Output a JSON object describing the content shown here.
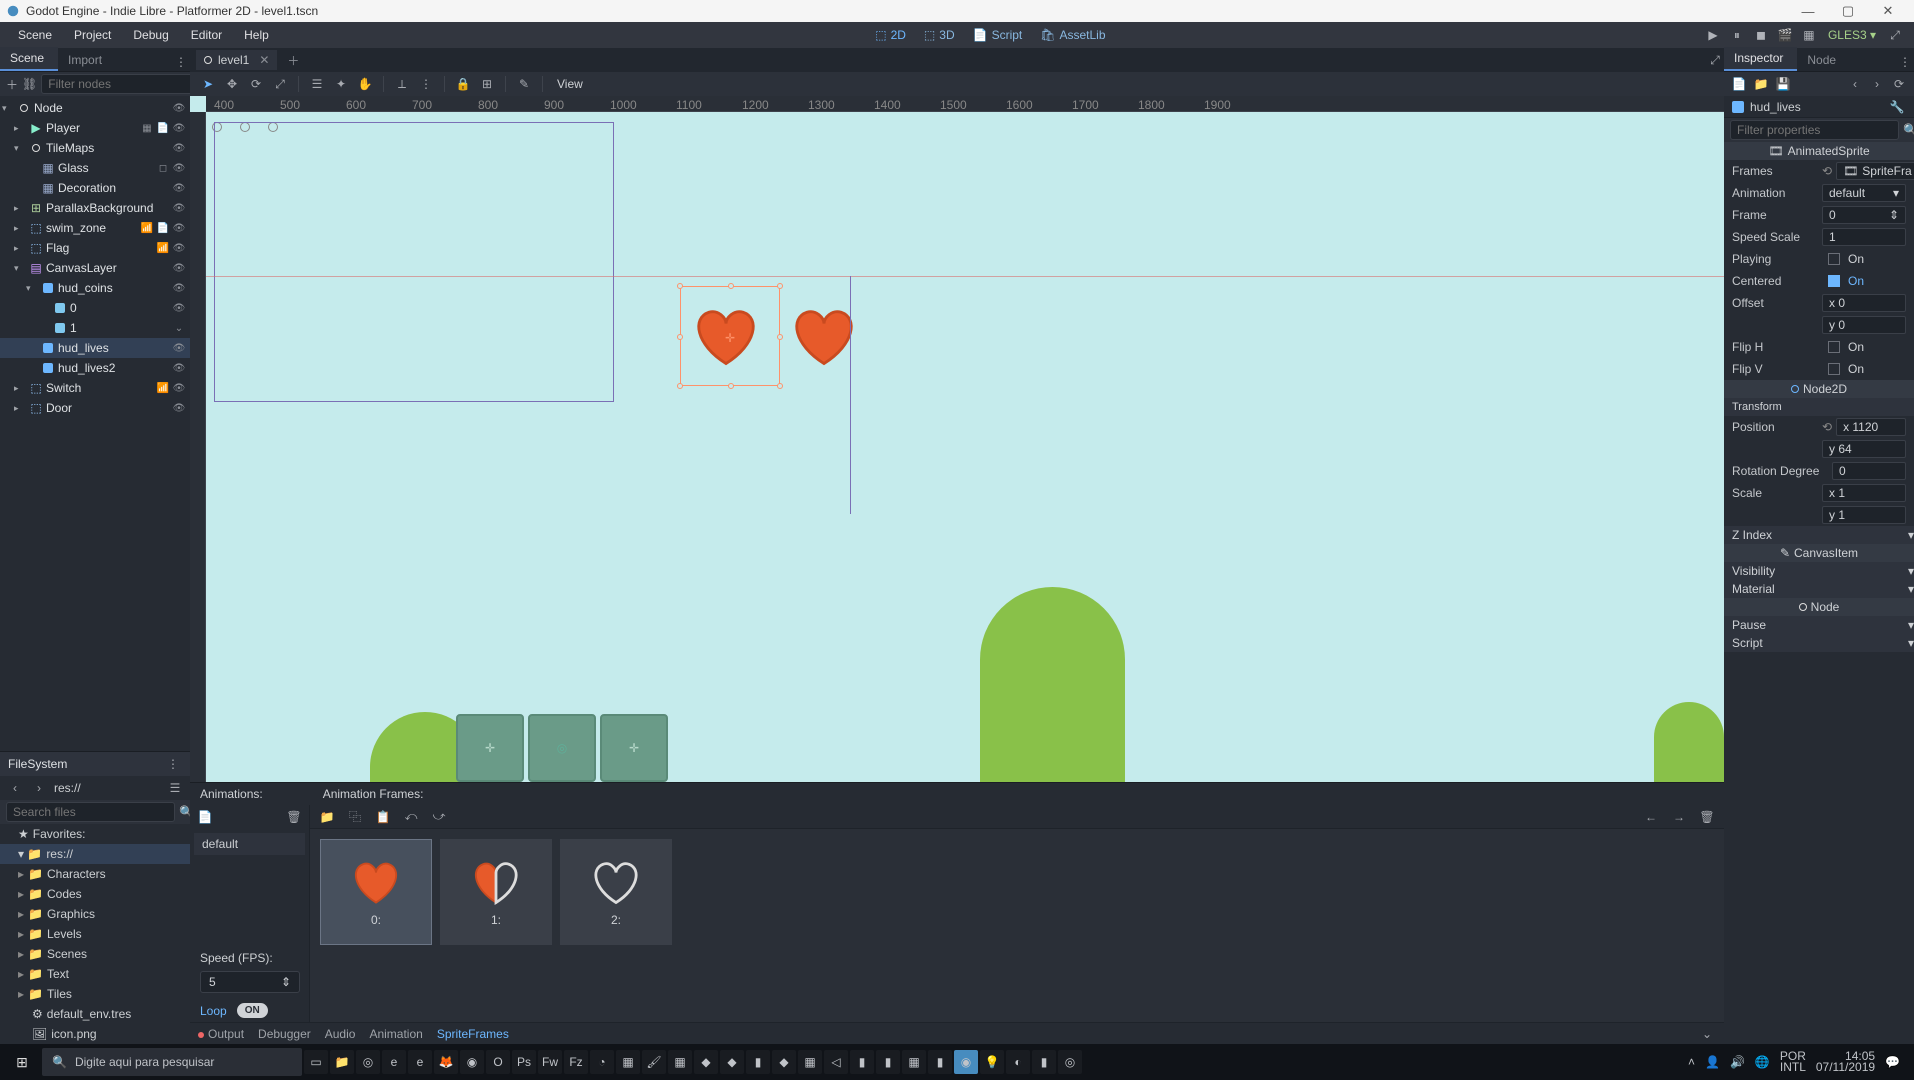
{
  "titlebar": {
    "text": "Godot Engine - Indie Libre - Platformer 2D - level1.tscn"
  },
  "menubar": {
    "items": [
      "Scene",
      "Project",
      "Debug",
      "Editor",
      "Help"
    ],
    "modes": {
      "m2d": "2D",
      "m3d": "3D",
      "script": "Script",
      "assetlib": "AssetLib"
    },
    "gles": "GLES3"
  },
  "left_tabs": {
    "scene": "Scene",
    "import": "Import"
  },
  "tree_filter_placeholder": "Filter nodes",
  "tree": [
    {
      "lvl": 0,
      "chev": "▾",
      "icon": "c-white",
      "label": "Node",
      "ract": [
        "👁"
      ]
    },
    {
      "lvl": 1,
      "chev": "▸",
      "icon": "play",
      "label": "Player",
      "ract": [
        "▦",
        "📄",
        "👁"
      ]
    },
    {
      "lvl": 1,
      "chev": "▾",
      "icon": "c-white",
      "label": "TileMaps",
      "ract": [
        "👁"
      ]
    },
    {
      "lvl": 2,
      "chev": "",
      "icon": "grid",
      "label": "Glass",
      "ract": [
        "◻",
        "👁"
      ]
    },
    {
      "lvl": 2,
      "chev": "",
      "icon": "grid",
      "label": "Decoration",
      "ract": [
        "👁"
      ]
    },
    {
      "lvl": 1,
      "chev": "▸",
      "icon": "plx",
      "label": "ParallaxBackground",
      "ract": [
        "👁"
      ]
    },
    {
      "lvl": 1,
      "chev": "▸",
      "icon": "area",
      "label": "swim_zone",
      "ract": [
        "📶",
        "📄",
        "👁"
      ]
    },
    {
      "lvl": 1,
      "chev": "▸",
      "icon": "area",
      "label": "Flag",
      "ract": [
        "📶",
        "👁"
      ]
    },
    {
      "lvl": 1,
      "chev": "▾",
      "icon": "layer",
      "label": "CanvasLayer",
      "ract": [
        "👁"
      ]
    },
    {
      "lvl": 2,
      "chev": "▾",
      "icon": "hud",
      "label": "hud_coins",
      "ract": [
        "👁"
      ]
    },
    {
      "lvl": 3,
      "chev": "",
      "icon": "spr",
      "label": "0",
      "ract": [
        "👁"
      ]
    },
    {
      "lvl": 3,
      "chev": "",
      "icon": "spr",
      "label": "1",
      "ract": [
        "⌄"
      ]
    },
    {
      "lvl": 2,
      "chev": "",
      "icon": "hud",
      "label": "hud_lives",
      "ract": [
        "👁"
      ],
      "sel": true
    },
    {
      "lvl": 2,
      "chev": "",
      "icon": "hud",
      "label": "hud_lives2",
      "ract": [
        "👁"
      ]
    },
    {
      "lvl": 1,
      "chev": "▸",
      "icon": "area",
      "label": "Switch",
      "ract": [
        "📶",
        "👁"
      ]
    },
    {
      "lvl": 1,
      "chev": "▸",
      "icon": "area",
      "label": "Door",
      "ract": [
        "👁"
      ]
    }
  ],
  "fs": {
    "title": "FileSystem",
    "path": "res://",
    "search_placeholder": "Search files",
    "fav": "Favorites:",
    "root": "res://",
    "folders": [
      "Characters",
      "Codes",
      "Graphics",
      "Levels",
      "Scenes",
      "Text",
      "Tiles"
    ],
    "files": [
      "default_env.tres",
      "icon.png"
    ]
  },
  "scenetab": {
    "name": "level1"
  },
  "view_label": "View",
  "ruler_marks": [
    "400",
    "500",
    "600",
    "700",
    "800",
    "900",
    "1000",
    "1100",
    "1200",
    "1300",
    "1400",
    "1500",
    "1600",
    "1700",
    "1800",
    "1900"
  ],
  "anim": {
    "hdr_anim": "Animations:",
    "hdr_frames": "Animation Frames:",
    "default": "default",
    "speed_lbl": "Speed (FPS):",
    "speed_val": "5",
    "loop_lbl": "Loop",
    "loop_on": "ON",
    "frame_labels": [
      "0:",
      "1:",
      "2:"
    ]
  },
  "bottom_tabs": {
    "output": "Output",
    "debugger": "Debugger",
    "audio": "Audio",
    "animation": "Animation",
    "spriteframes": "SpriteFrames"
  },
  "inspector": {
    "tabs": {
      "inspector": "Inspector",
      "node": "Node"
    },
    "node": "hud_lives",
    "filter_placeholder": "Filter properties",
    "class": "AnimatedSprite",
    "props": {
      "frames_lbl": "Frames",
      "frames_val": "SpriteFra",
      "animation_lbl": "Animation",
      "animation_val": "default",
      "frame_lbl": "Frame",
      "frame_val": "0",
      "speed_lbl": "Speed Scale",
      "speed_val": "1",
      "playing_lbl": "Playing",
      "playing_on": "On",
      "centered_lbl": "Centered",
      "centered_on": "On",
      "offset_lbl": "Offset",
      "offset_x": "x  0",
      "offset_y": "y  0",
      "fliph_lbl": "Flip H",
      "fliph_on": "On",
      "flipv_lbl": "Flip V",
      "flipv_on": "On"
    },
    "node2d": "Node2D",
    "transform": "Transform",
    "pos": {
      "lbl": "Position",
      "x": "x  1120",
      "y": "y  64"
    },
    "rot": {
      "lbl": "Rotation Degree",
      "val": "0"
    },
    "scale": {
      "lbl": "Scale",
      "x": "x  1",
      "y": "y  1"
    },
    "zindex": "Z Index",
    "canvasitem": "CanvasItem",
    "visibility": "Visibility",
    "material": "Material",
    "nodecls": "Node",
    "pause": "Pause",
    "script": "Script"
  },
  "taskbar": {
    "search_placeholder": "Digite aqui para pesquisar",
    "lang": "POR",
    "kbd": "INTL",
    "time": "14:05",
    "date": "07/11/2019"
  }
}
